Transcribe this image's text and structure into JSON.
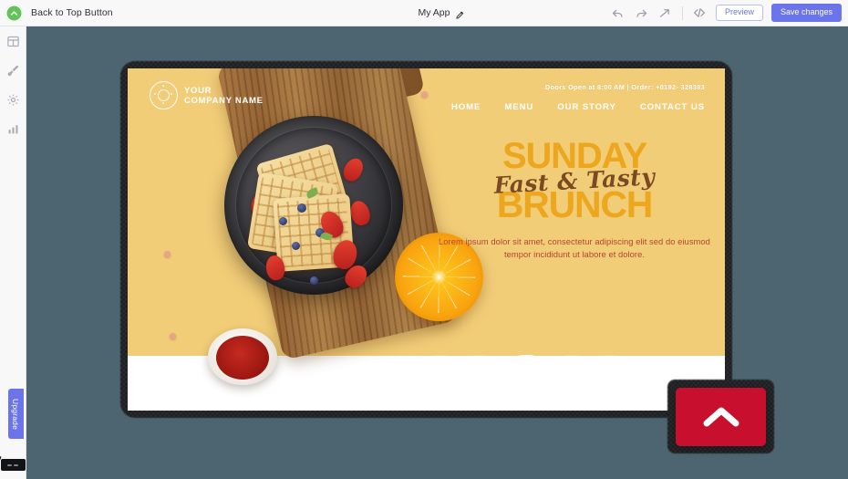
{
  "topbar": {
    "component_badge_icon": "chevron-up-circle-icon",
    "component_label": "Back to Top Button",
    "app_title": "My App",
    "edit_icon": "pencil-icon",
    "undo_icon": "undo-arrow-icon",
    "redo_icon": "redo-arrow-icon",
    "publish_icon": "publish-arrow-icon",
    "code_icon": "code-brackets-icon",
    "preview_label": "Preview",
    "save_label": "Save changes",
    "accent_color": "#6b74e8",
    "badge_color": "#64c25a"
  },
  "rail": {
    "items": [
      {
        "name": "layout",
        "icon": "grid-layout-icon"
      },
      {
        "name": "design",
        "icon": "paint-brush-icon"
      },
      {
        "name": "settings",
        "icon": "gear-icon"
      },
      {
        "name": "analytics",
        "icon": "bar-chart-icon"
      }
    ],
    "upgrade_label": "Upgrade",
    "cursor_chip_icon": "mouse-pointer-chip-icon"
  },
  "stage": {
    "background_color": "#4c6570"
  },
  "page": {
    "background_color": "#f2cd78",
    "logo": {
      "mark_icon": "donut-ring-icon",
      "line1": "YOUR",
      "line2": "COMPANY NAME"
    },
    "meta": "Doors Open at 8:00 AM  |  Order: +0192- 328383",
    "nav": [
      "HOME",
      "MENU",
      "OUR STORY",
      "CONTACT US"
    ],
    "hero": {
      "line1": "SUNDAY",
      "script": "Fast & Tasty",
      "line2": "BRUNCH",
      "body": "Lorem ipsum dolor sit amet, consectetur adipiscing elit sed do eiusmod tempor incididunt ut labore et dolore.",
      "heading_color": "#eca71e",
      "script_color": "#7b4a22",
      "body_color": "#b4452f"
    },
    "wordmark": "BRUNCH",
    "food": {
      "board_icon": "wooden-cutting-board",
      "plate_icon": "dark-ceramic-plate",
      "waffles_icon": "waffle-stack",
      "orange_icon": "orange-half",
      "sauce_icon": "ketchup-bowl"
    }
  },
  "back_to_top": {
    "icon": "chevron-up-icon",
    "color": "#c8102e",
    "selected": true
  }
}
